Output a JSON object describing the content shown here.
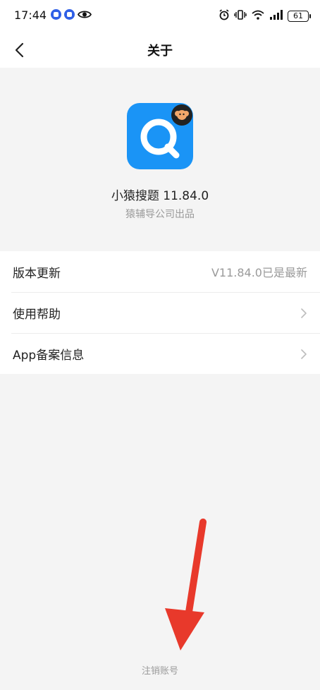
{
  "status_bar": {
    "time": "17:44",
    "battery": "61",
    "icons_left": [
      "app-notification-icon",
      "app-notification-icon",
      "eye-icon"
    ],
    "icons_right": [
      "alarm-icon",
      "vibrate-icon",
      "wifi-icon",
      "signal-icon",
      "battery-icon"
    ]
  },
  "nav": {
    "title": "关于",
    "back_icon": "back-arrow-icon"
  },
  "app": {
    "name": "小猿搜题 11.84.0",
    "publisher": "猿辅导公司出品",
    "icon_color": "#1a94f6"
  },
  "settings": [
    {
      "label": "版本更新",
      "value": "V11.84.0已是最新"
    },
    {
      "label": "使用帮助",
      "value": ""
    },
    {
      "label": "App备案信息",
      "value": ""
    }
  ],
  "footer": {
    "logout": "注销账号"
  },
  "annotation": {
    "arrow_color": "#e8392b"
  }
}
